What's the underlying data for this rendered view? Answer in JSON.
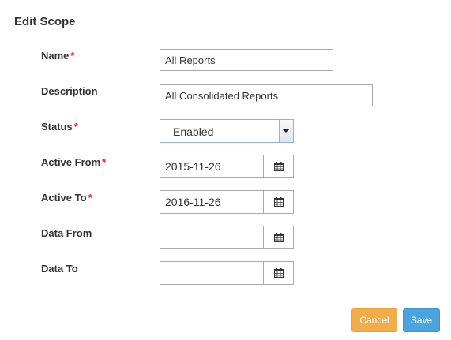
{
  "form": {
    "title": "Edit Scope",
    "required_mark": "*",
    "name": {
      "label": "Name",
      "value": "All Reports"
    },
    "description": {
      "label": "Description",
      "value": "All Consolidated Reports"
    },
    "status": {
      "label": "Status",
      "value": "Enabled"
    },
    "active_from": {
      "label": "Active From",
      "value": "2015-11-26"
    },
    "active_to": {
      "label": "Active To",
      "value": "2016-11-26"
    },
    "data_from": {
      "label": "Data From",
      "value": ""
    },
    "data_to": {
      "label": "Data To",
      "value": ""
    }
  },
  "buttons": {
    "cancel": "Cancel",
    "save": "Save"
  },
  "colors": {
    "required": "#d9201f",
    "cancel": "#f0ad4e",
    "save": "#4ca3dd"
  },
  "icons": {
    "calendar": "calendar-icon",
    "dropdown": "chevron-down-icon"
  }
}
